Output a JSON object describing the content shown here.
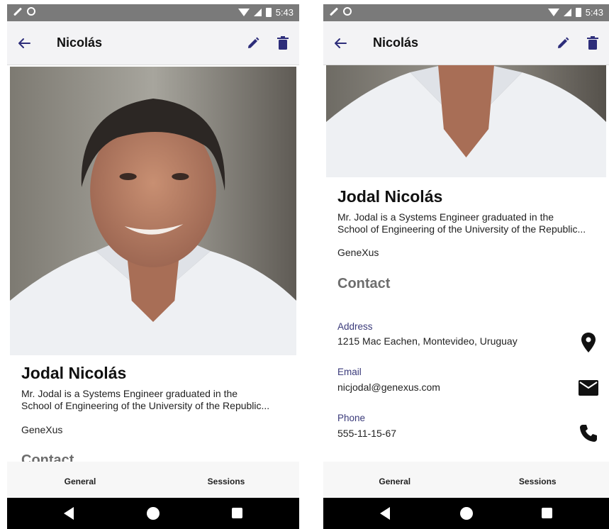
{
  "status_bar": {
    "time": "5:43"
  },
  "app_bar": {
    "title": "Nicolás"
  },
  "profile": {
    "name": "Jodal Nicolás",
    "description": "Mr. Jodal is a Systems Engineer graduated in the",
    "description_line2": "School of Engineering of the University of the Republic...",
    "company": "GeneXus"
  },
  "contact": {
    "section_title": "Contact",
    "address_label": "Address",
    "address_value": "1215 Mac Eachen, Montevideo, Uruguay",
    "email_label": "Email",
    "email_value": "nicjodal@genexus.com",
    "phone_label": "Phone",
    "phone_value": "555-11-15-67"
  },
  "tabs": [
    {
      "label": "General",
      "selected": true
    },
    {
      "label": "Sessions",
      "selected": false
    }
  ],
  "icons": {
    "back": "arrow-left-icon",
    "edit": "pencil-icon",
    "delete": "trash-icon",
    "address": "map-pin-icon",
    "email": "envelope-icon",
    "phone": "phone-icon"
  },
  "colors": {
    "status_bar": "#7a7a7a",
    "app_bar": "#f3f3f5",
    "accent_icon": "#2d2d7a",
    "tab_indicator": "#2a9d99",
    "contact_label": "#3a3a7a"
  }
}
